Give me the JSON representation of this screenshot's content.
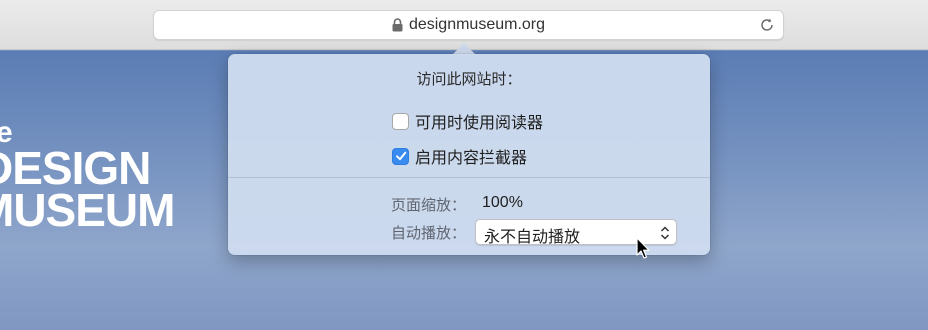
{
  "browser": {
    "url": "designmuseum.org",
    "icons": {
      "lock": "lock-icon",
      "reload": "reload-icon"
    }
  },
  "page": {
    "logo_lines": [
      "e",
      "DESIGN",
      "MUSEUM"
    ]
  },
  "popover": {
    "title": "访问此网站时：",
    "options": [
      {
        "label": "可用时使用阅读器",
        "checked": false
      },
      {
        "label": "启用内容拦截器",
        "checked": true
      }
    ],
    "zoom_label": "页面缩放：",
    "zoom_value": "100%",
    "autoplay_label": "自动播放：",
    "autoplay_value": "永不自动播放"
  },
  "colors": {
    "accent": "#3a8bf0",
    "popover_bg": "#cddbee",
    "page_sky": "#6f8fbf"
  }
}
